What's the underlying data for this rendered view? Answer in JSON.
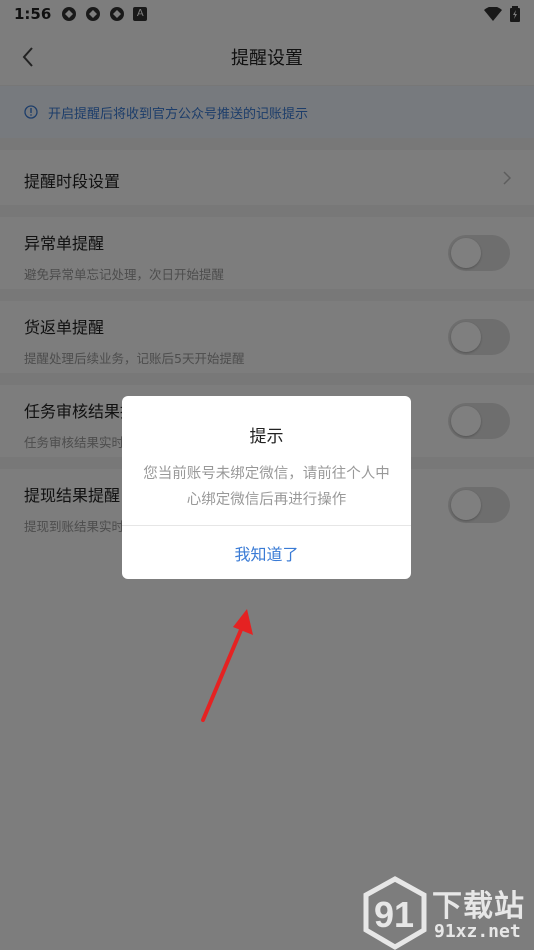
{
  "status_bar": {
    "time": "1:56",
    "notif_icon_letter": "A"
  },
  "header": {
    "title": "提醒设置"
  },
  "notice": {
    "text": "开启提醒后将收到官方公众号推送的记账提示"
  },
  "settings": {
    "period": {
      "label": "提醒时段设置"
    },
    "items": [
      {
        "title": "异常单提醒",
        "subtitle": "避免异常单忘记处理，次日开始提醒",
        "enabled": false
      },
      {
        "title": "货返单提醒",
        "subtitle": "提醒处理后续业务，记账后5天开始提醒",
        "enabled": false
      },
      {
        "title": "任务审核结果提",
        "subtitle": "任务审核结果实时",
        "enabled": false
      },
      {
        "title": "提现结果提醒",
        "subtitle": "提现到账结果实时",
        "enabled": false
      }
    ]
  },
  "dialog": {
    "title": "提示",
    "message": "您当前账号未绑定微信，请前往个人中心绑定微信后再进行操作",
    "confirm_label": "我知道了"
  },
  "watermark": {
    "line1": "下载站",
    "line2": "91xz.net"
  },
  "colors": {
    "accent": "#3a7bd5",
    "annotation_arrow": "#e52222"
  }
}
